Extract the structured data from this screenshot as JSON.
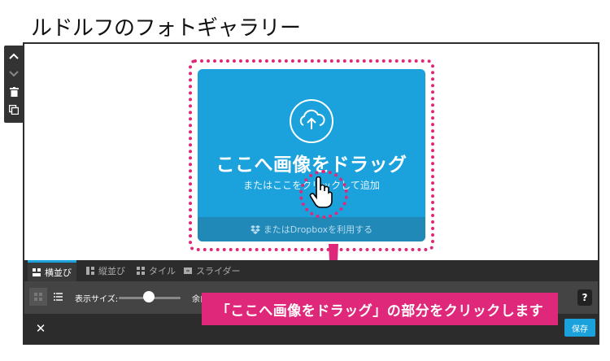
{
  "page_title": "ルドルフのフォトギャラリー",
  "side_toolbar": {
    "icons": [
      "chevron-up-icon",
      "chevron-down-icon",
      "trash-icon",
      "duplicate-icon"
    ]
  },
  "upload": {
    "title": "ここへ画像をドラッグ",
    "subtitle": "またはここをクリックして追加",
    "dropbox_text": "またはDropboxを利用する",
    "accent_color": "#1ba2dc"
  },
  "tabs": [
    {
      "label": "横並び",
      "active": true
    },
    {
      "label": "縦並び",
      "active": false
    },
    {
      "label": "タイル",
      "active": false
    },
    {
      "label": "スライダー",
      "active": false
    }
  ],
  "settings": {
    "display_size_label": "表示サイズ:",
    "margin_label": "余白",
    "help_label": "?"
  },
  "footer": {
    "close_label": "✕",
    "save_label": "保存"
  },
  "callout": {
    "text": "「ここへ画像をドラッグ」の部分をクリックします",
    "color": "#e0287a"
  }
}
